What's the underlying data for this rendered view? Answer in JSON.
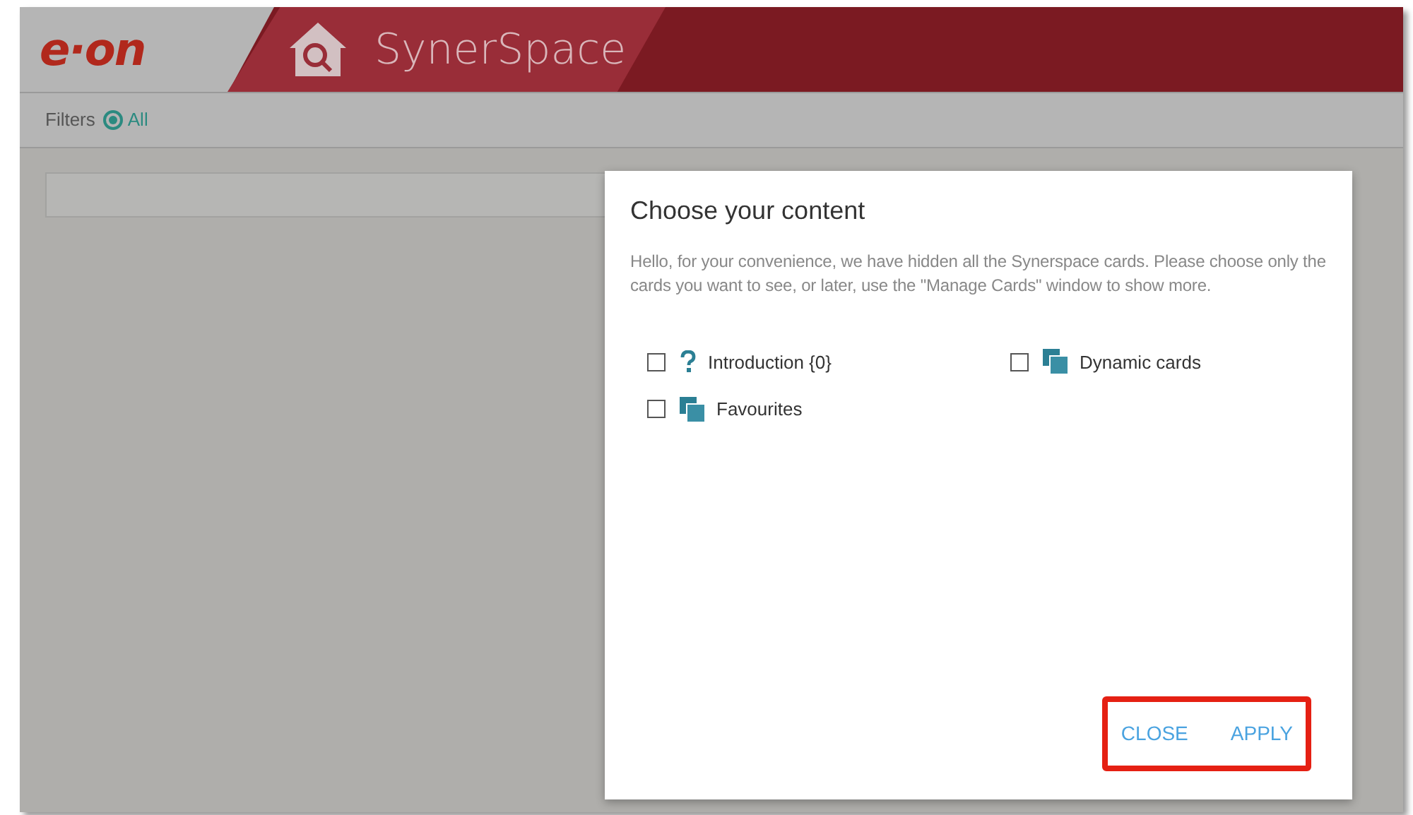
{
  "header": {
    "logo": "e·on",
    "title": "SynerSpace"
  },
  "filters": {
    "label": "Filters",
    "options": [
      {
        "label": "All",
        "selected": true
      }
    ]
  },
  "dialog": {
    "title": "Choose your content",
    "message": "Hello, for your convenience, we have hidden all the Synerspace cards. Please choose only the cards you want to see, or later, use the \"Manage Cards\" window to show more.",
    "cards": [
      {
        "label": "Introduction {0}",
        "kind": "question",
        "checked": false
      },
      {
        "label": "Dynamic cards",
        "kind": "cards",
        "checked": false
      },
      {
        "label": "Favourites",
        "kind": "cards",
        "checked": false
      }
    ],
    "buttons": [
      {
        "label": "CLOSE"
      },
      {
        "label": "APPLY"
      }
    ],
    "buttons_highlighted": true
  }
}
